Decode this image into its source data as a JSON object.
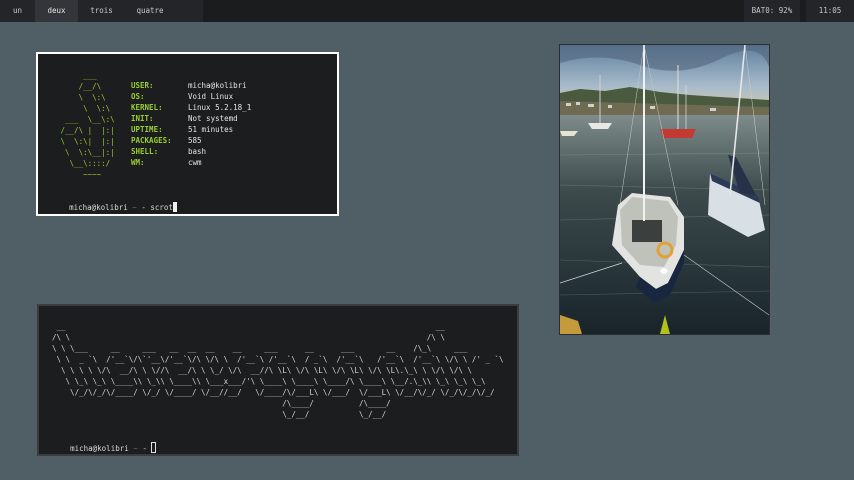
{
  "bar": {
    "workspaces": [
      {
        "label": "un",
        "active": false
      },
      {
        "label": "deux",
        "active": true
      },
      {
        "label": "trois",
        "active": false
      },
      {
        "label": "quatre",
        "active": false
      }
    ],
    "battery": "BAT0: 92%",
    "clock": "11:05"
  },
  "fetch_terminal": {
    "logo_art": "      ___\n     /__/\\\n     \\  \\:\\\n      \\  \\:\\\n  ___  \\__\\:\\\n /__/\\ |  |:|\n \\  \\:\\|  |:|\n  \\  \\:\\__|:|\n   \\__\\::::/\n      ~~~~",
    "info": [
      {
        "key": "USER:",
        "value": "micha@kolibri"
      },
      {
        "key": "OS:",
        "value": "Void Linux"
      },
      {
        "key": "KERNEL:",
        "value": "Linux 5.2.18_1"
      },
      {
        "key": "INIT:",
        "value": "Not systemd"
      },
      {
        "key": "UPTIME:",
        "value": "51 minutes"
      },
      {
        "key": "PACKAGES:",
        "value": "585"
      },
      {
        "key": "SHELL:",
        "value": "bash"
      },
      {
        "key": "WM:",
        "value": "cwm"
      }
    ],
    "prompt_user": "micha@kolibri",
    "prompt_sep": " ~ ",
    "prompt_cmd": "- scrot"
  },
  "banner_terminal": {
    "banner_art": " __                                                                                  __\n/\\ \\                                                                               /\\ \\\n\\ \\ \\___     __     ___   __  __  __    __     ___      __      ___       __    /\\_\\     ___\n \\ \\  _ `\\  /'__`\\/\\`'__\\/'__`\\/\\ \\/\\ \\  /'__`\\ /'__`\\  / _`\\  /'__`\\   /'__`\\  /'__`\\ \\/\\ \\ /' _ `\\\n  \\ \\ \\ \\ \\/\\  __/\\ \\ \\//\\  __/\\ \\ \\_/ \\/\\  __//\\ \\L\\ \\/\\ \\L\\ \\/\\ \\L\\ \\/\\ \\L\\.\\_\\ \\ \\/\\ \\/\\ \\\n   \\ \\_\\ \\_\\ \\____\\\\ \\_\\\\ \\____\\\\ \\___x___/'\\ \\____\\ \\____\\ \\____/\\ \\____\\ \\__/.\\_\\\\ \\_\\ \\_\\ \\_\\\n    \\/_/\\/_/\\/____/ \\/_/ \\/____/ \\/__//__/   \\/____/\\/___L\\ \\/___/  \\/___L\\ \\/__/\\/_/ \\/_/\\/_/\\/_/\n                                                   /\\____/          /\\____/\n                                                   \\_/__/           \\_/__/",
    "prompt_user": "micha@kolibri",
    "prompt_sep": " ~ ",
    "prompt_cmd": "- "
  },
  "colors": {
    "desktop": "#4f5f65",
    "bar": "#1b1c1e",
    "terminal_bg": "#1c1d1f",
    "accent_green": "#9acd32",
    "focus_border": "#ffffff"
  },
  "photo": {
    "subject": "sailboats-moored-in-harbor"
  }
}
